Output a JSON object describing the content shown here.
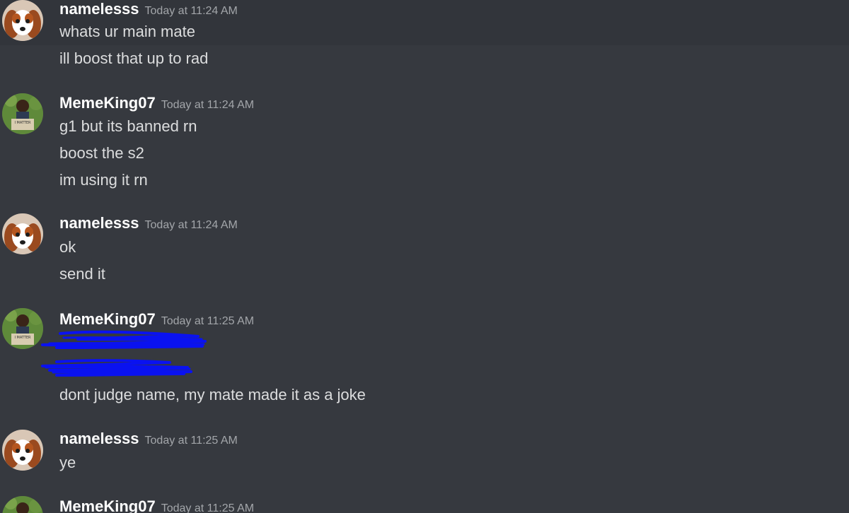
{
  "messages": [
    {
      "username": "namelesss",
      "timestamp": "Today at 11:24 AM",
      "avatar": "dog-avatar",
      "lines": [
        "whats ur main mate",
        "ill boost that up to rad"
      ]
    },
    {
      "username": "MemeKing07",
      "timestamp": "Today at 11:24 AM",
      "avatar": "child-sign-avatar",
      "lines": [
        "g1 but its banned rn",
        "boost the s2",
        "im using it rn"
      ]
    },
    {
      "username": "namelesss",
      "timestamp": "Today at 11:24 AM",
      "avatar": "dog-avatar",
      "lines": [
        "ok",
        "send it"
      ]
    },
    {
      "username": "MemeKing07",
      "timestamp": "Today at 11:25 AM",
      "avatar": "child-sign-avatar",
      "redacted_lines": 2,
      "lines": [
        "dont judge name, my mate made it as a joke"
      ]
    },
    {
      "username": "namelesss",
      "timestamp": "Today at 11:25 AM",
      "avatar": "dog-avatar",
      "lines": [
        "ye"
      ]
    },
    {
      "username": "MemeKing07",
      "timestamp": "Today at 11:25 AM",
      "avatar": "child-sign-avatar",
      "lines": []
    }
  ],
  "sign_text": "I MATTER",
  "colors": {
    "background": "#36393f",
    "hover_background": "#32353b",
    "username": "#ffffff",
    "timestamp": "#a3a6aa",
    "message_text": "#dcddde",
    "redaction": "#0a12f0"
  }
}
